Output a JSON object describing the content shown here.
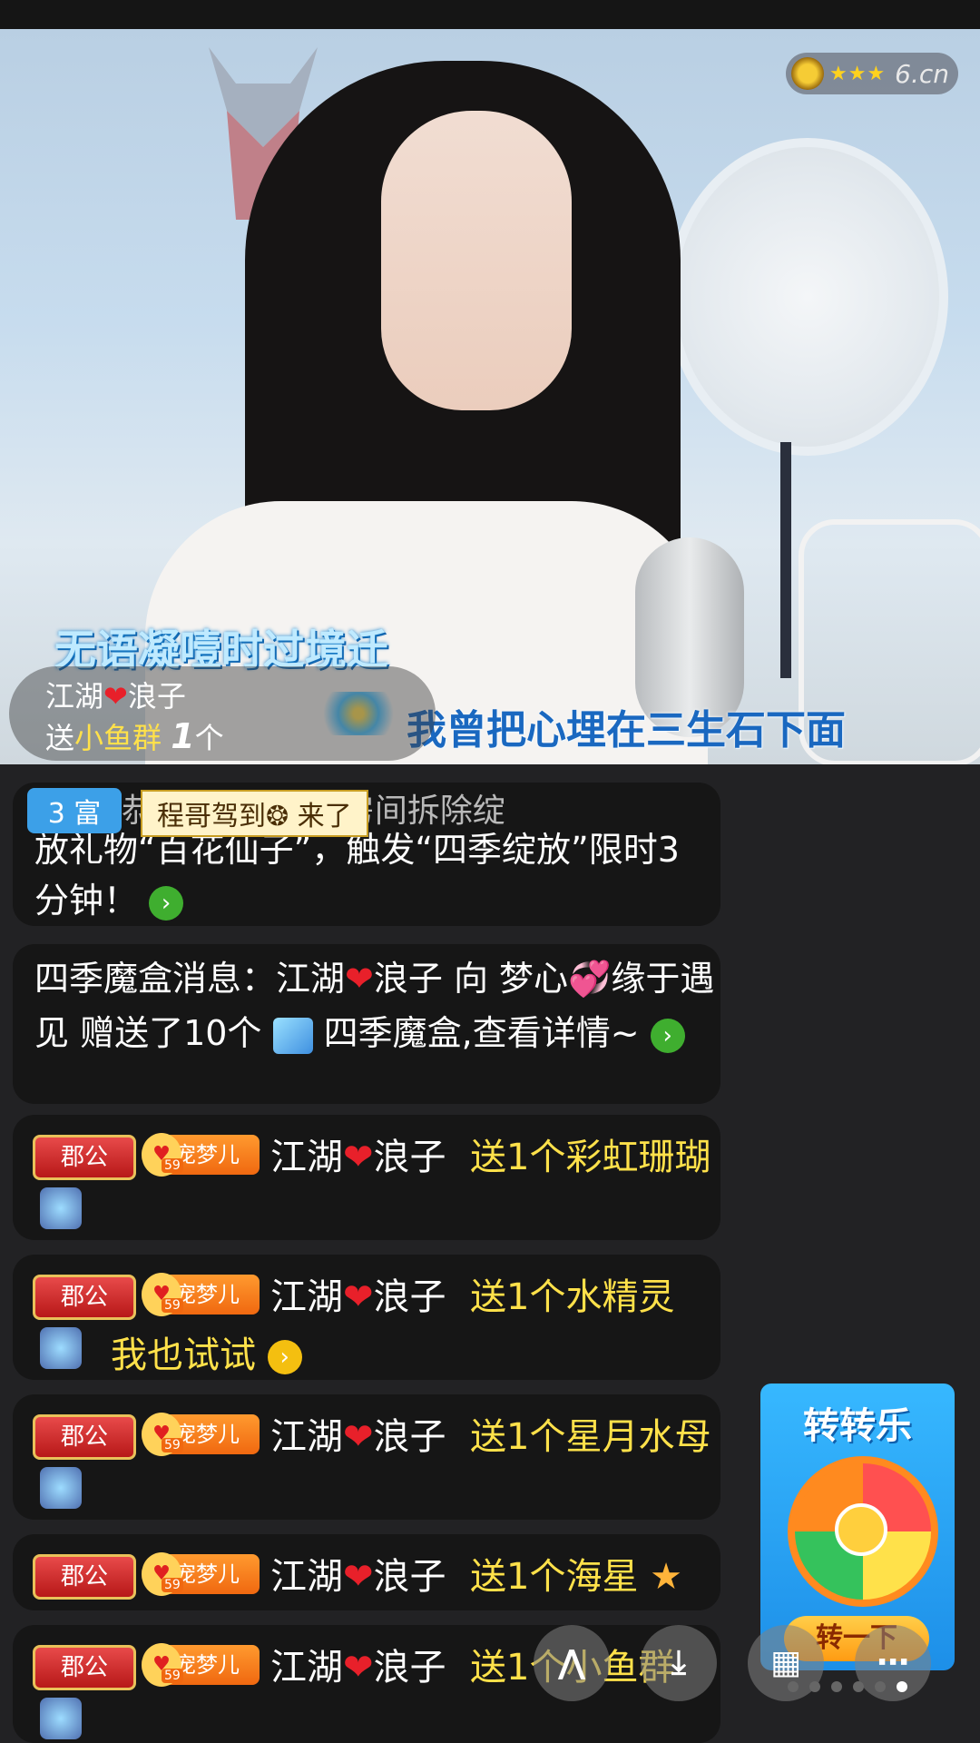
{
  "video": {
    "lyric_line1": "无语凝噎时过境迁",
    "lyric_line2": "我曾把心埋在三生石下面",
    "rating": {
      "stars": "★★★",
      "logo": "6.cn"
    },
    "gift_banner": {
      "sender_left": "江湖",
      "sender_right": "浪子",
      "prefix": "送",
      "gift_name": "小鱼群",
      "count": "1",
      "unit": "个"
    }
  },
  "chat": {
    "rich_badge": "3 富",
    "enter_banner": "程哥驾到❂ 来了",
    "system1": {
      "hidden_top": "恭喜... 绽放 ✿ 房间拆除绽",
      "text": "放礼物“百花仙子”，触发“四季绽放”限时3分钟！"
    },
    "system2": {
      "text_a": "四季魔盒消息：江湖",
      "text_b": "浪子 向 梦心",
      "text_c": "缘于遇见 赠送了10个",
      "text_d": "四季魔盒,查看详情~"
    },
    "rows": [
      {
        "title_badge": "郡公",
        "pet_badge": "宠梦儿",
        "pet_level": "59",
        "nick_left": "江湖",
        "nick_right": "浪子",
        "gift": "送1个彩虹珊瑚"
      },
      {
        "title_badge": "郡公",
        "pet_badge": "宠梦儿",
        "pet_level": "59",
        "nick_left": "江湖",
        "nick_right": "浪子",
        "gift": "送1个水精灵",
        "try_label": "我也试试"
      },
      {
        "title_badge": "郡公",
        "pet_badge": "宠梦儿",
        "pet_level": "59",
        "nick_left": "江湖",
        "nick_right": "浪子",
        "gift": "送1个星月水母"
      },
      {
        "title_badge": "郡公",
        "pet_badge": "宠梦儿",
        "pet_level": "59",
        "nick_left": "江湖",
        "nick_right": "浪子",
        "gift": "送1个海星"
      },
      {
        "title_badge": "郡公",
        "pet_badge": "宠梦儿",
        "pet_level": "59",
        "nick_left": "江湖",
        "nick_right": "浪子",
        "gift": "送1个小鱼群"
      }
    ]
  },
  "promo": {
    "title": "转转乐",
    "button": "转一下"
  },
  "controls": {
    "fab1_icon": "share-icon",
    "fab2_icon": "download-icon",
    "fab3_icon": "grid-icon",
    "fab4_icon": "more-icon"
  }
}
